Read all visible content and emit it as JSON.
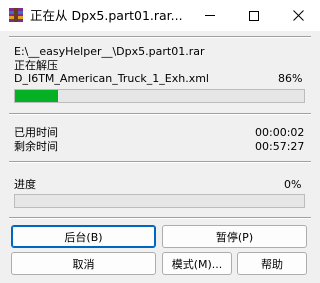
{
  "window": {
    "title": "正在从 Dpx5.part01.rar...",
    "app_icon": "winrar-icon"
  },
  "extract": {
    "archive_path": "E:\\__easyHelper__\\Dpx5.part01.rar",
    "action_label": "正在解压",
    "current_file": "D_I6TM_American_Truck_1_Exh.xml",
    "file_percent_text": "86%",
    "file_progress": 0.15
  },
  "time": {
    "elapsed_label": "已用时间",
    "elapsed_value": "00:00:02",
    "remaining_label": "剩余时间",
    "remaining_value": "00:57:27"
  },
  "overall": {
    "label": "进度",
    "percent_text": "0%",
    "progress": 0
  },
  "buttons": {
    "background": "后台(B)",
    "pause": "暂停(P)",
    "cancel": "取消",
    "mode": "模式(M)...",
    "help": "帮助"
  },
  "colors": {
    "progress_fill": "#06b025",
    "close_hover": "#e81123",
    "default_button_border": "#0067c0"
  }
}
